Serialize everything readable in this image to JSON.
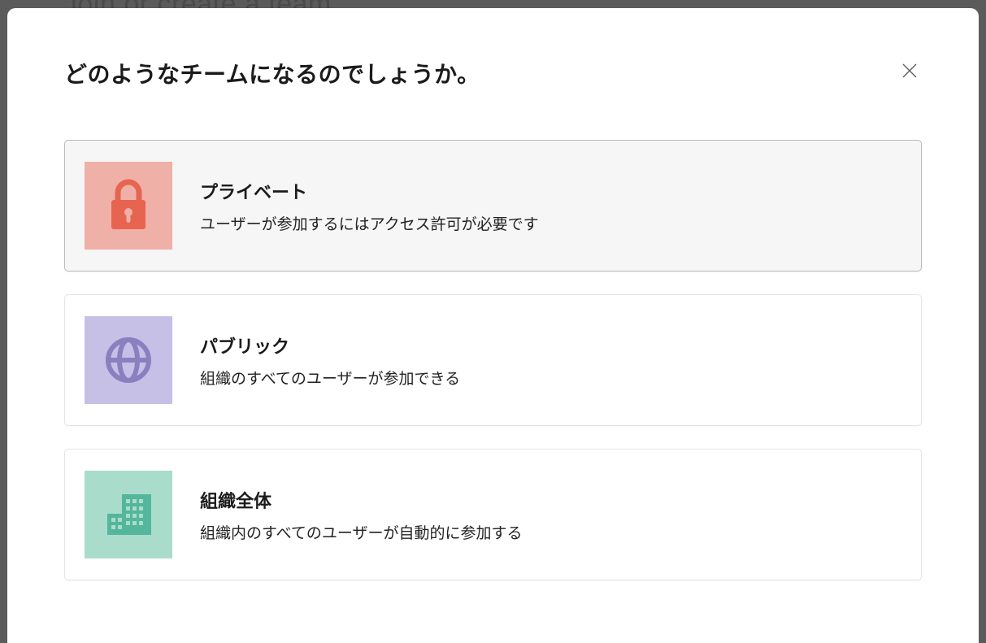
{
  "background": {
    "hint_text": "Join or create a team"
  },
  "dialog": {
    "title": "どのようなチームになるのでしょうか。",
    "options": [
      {
        "title": "プライベート",
        "description": "ユーザーが参加するにはアクセス許可が必要です",
        "icon": "lock-icon",
        "tile_color": "#efb0a7"
      },
      {
        "title": "パブリック",
        "description": "組織のすべてのユーザーが参加できる",
        "icon": "globe-icon",
        "tile_color": "#c6bfe6"
      },
      {
        "title": "組織全体",
        "description": "組織内のすべてのユーザーが自動的に参加する",
        "icon": "building-icon",
        "tile_color": "#aadccc"
      }
    ]
  }
}
